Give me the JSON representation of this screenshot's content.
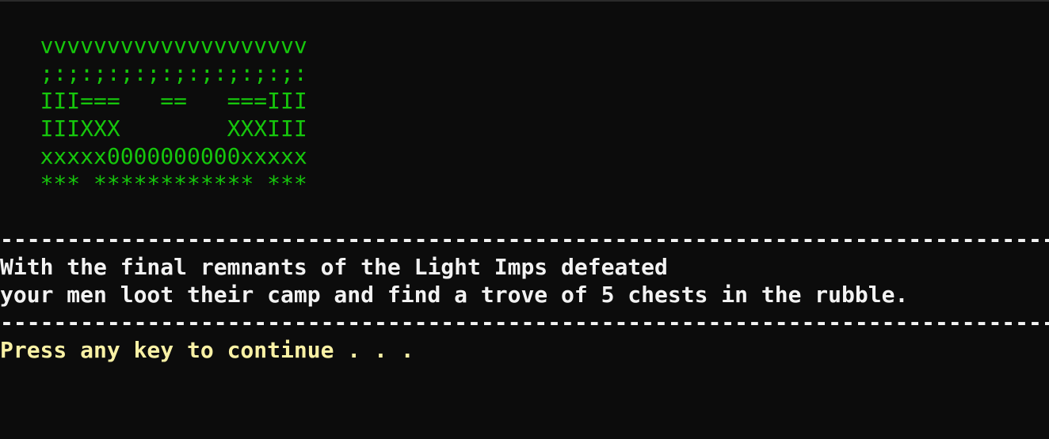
{
  "console": {
    "art_lines": [
      "   vvvvvvvvvvvvvvvvvvvv",
      "   ;:;:;:;:;:;:;:;:;:;:",
      "   III===   ==   ===III",
      "   IIIXXX        XXXIII",
      "   xxxxx0000000000xxxxx",
      "   *** ************ ***"
    ],
    "divider_top": "---------------------------------------------------------------------------------",
    "message_lines": [
      "With the final remnants of the Light Imps defeated",
      "your men loot their camp and find a trove of 5 chests in the rubble."
    ],
    "divider_bottom": "---------------------------------------------------------------------------------",
    "prompt": "Press any key to continue . . ."
  },
  "colors": {
    "background": "#0c0c0c",
    "art": "#16c60c",
    "text": "#f2f2f2",
    "prompt": "#f9f1a5"
  }
}
